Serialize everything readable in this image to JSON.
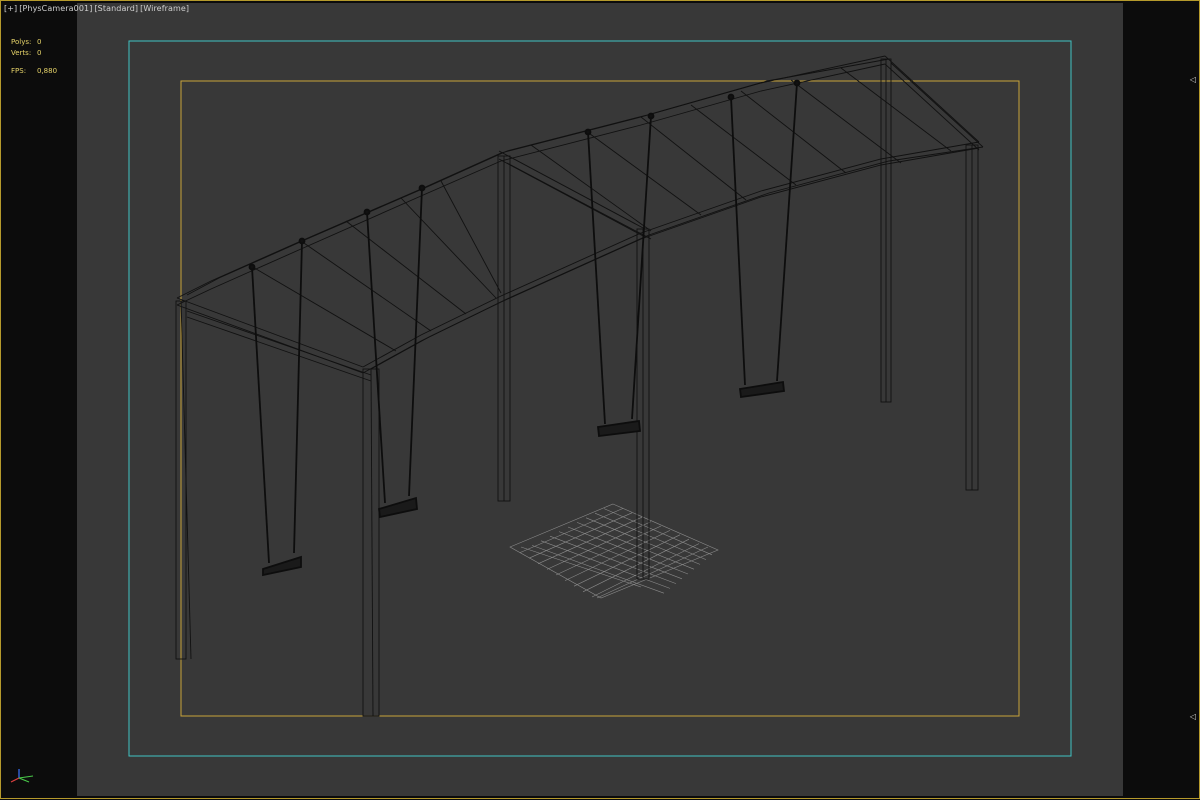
{
  "viewport": {
    "menu_plus": "[+]",
    "camera_name": "[PhysCamera001]",
    "shading_mode": "[Standard]",
    "display_mode": "[Wireframe]"
  },
  "stats": {
    "polys_label": "Polys:",
    "polys_value": "0",
    "verts_label": "Verts:",
    "verts_value": "0",
    "fps_label": "FPS:",
    "fps_value": "0,880"
  },
  "colors": {
    "viewport_border": "#b59a2c",
    "safe_frame_outer": "#3fc3c3",
    "safe_frame_inner": "#c9a43a",
    "scene_background": "#383838",
    "wire": "#111111"
  },
  "icons": {
    "upper_arrow": "◁",
    "lower_arrow": "◁",
    "axis": "axis-tripod-icon"
  }
}
